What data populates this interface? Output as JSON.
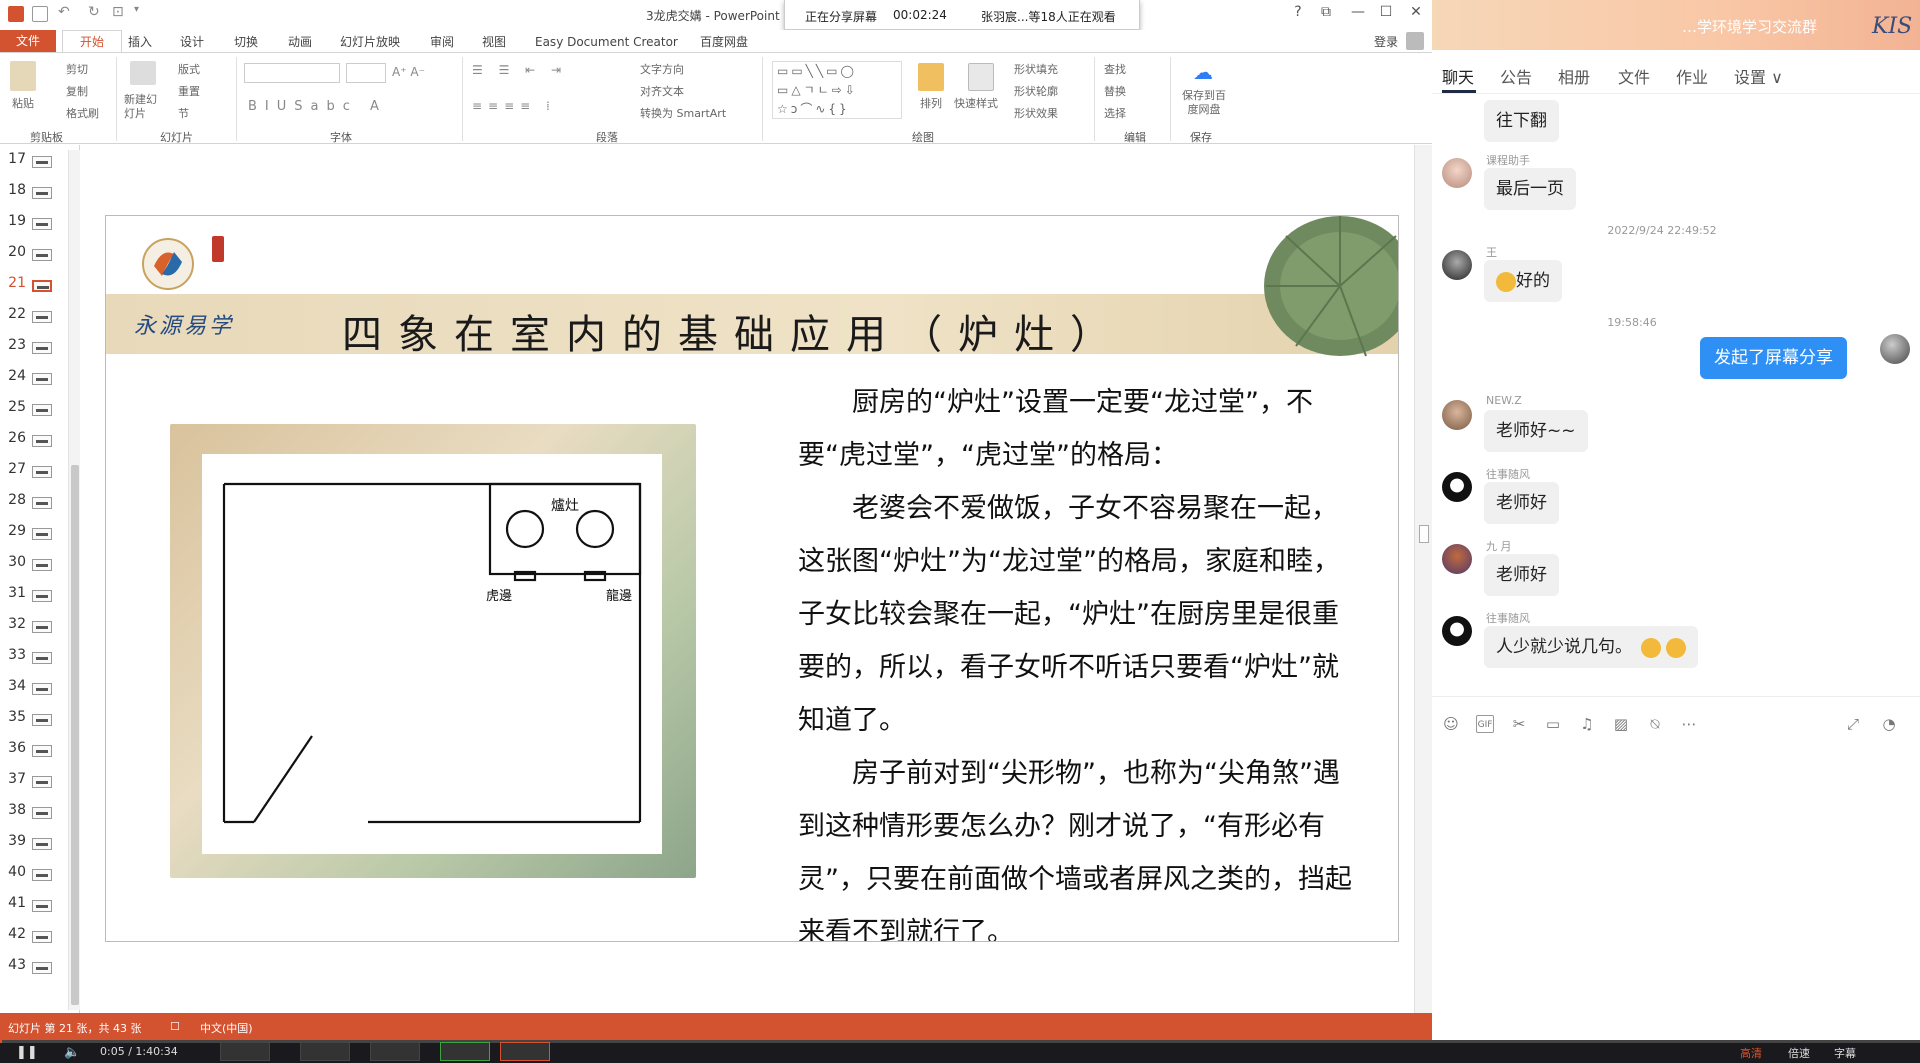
{
  "ppt": {
    "title": "3龙虎交媾 - PowerPoint",
    "share_banner": {
      "status": "正在分享屏幕",
      "timer": "00:02:24",
      "viewers": "张羽宸...等18人正在观看"
    },
    "window_controls": [
      "?",
      "⧉",
      "—",
      "☐",
      "✕"
    ],
    "login": "登录",
    "tabs": [
      "文件",
      "开始",
      "插入",
      "设计",
      "切换",
      "动画",
      "幻灯片放映",
      "审阅",
      "视图",
      "Easy Document Creator",
      "百度网盘"
    ],
    "active_tab": "开始",
    "ribbon": {
      "clipboard": {
        "paste": "粘贴",
        "cut": "剪切",
        "copy": "复制",
        "format_painter": "格式刷",
        "label": "剪贴板"
      },
      "slides": {
        "new_slide": "新建幻灯片",
        "layout": "版式",
        "reset": "重置",
        "section": "节",
        "label": "幻灯片"
      },
      "font": {
        "label": "字体"
      },
      "paragraph": {
        "text_direction": "文字方向",
        "align_text": "对齐文本",
        "smartart": "转换为 SmartArt",
        "label": "段落"
      },
      "drawing": {
        "arrange": "排列",
        "quick_styles": "快速样式",
        "shape_fill": "形状填充",
        "shape_outline": "形状轮廓",
        "shape_effects": "形状效果",
        "label": "绘图"
      },
      "editing": {
        "find": "查找",
        "replace": "替换",
        "select": "选择",
        "label": "编辑"
      },
      "save": {
        "save_baidu": "保存到百度网盘",
        "label": "保存"
      }
    },
    "thumbnails": [
      {
        "num": "17"
      },
      {
        "num": "18"
      },
      {
        "num": "19"
      },
      {
        "num": "20"
      },
      {
        "num": "21"
      },
      {
        "num": "22"
      },
      {
        "num": "23"
      },
      {
        "num": "24"
      },
      {
        "num": "25"
      },
      {
        "num": "26"
      },
      {
        "num": "27"
      },
      {
        "num": "28"
      },
      {
        "num": "29"
      },
      {
        "num": "30"
      },
      {
        "num": "31"
      },
      {
        "num": "32"
      },
      {
        "num": "33"
      },
      {
        "num": "34"
      },
      {
        "num": "35"
      },
      {
        "num": "36"
      },
      {
        "num": "37"
      },
      {
        "num": "38"
      },
      {
        "num": "39"
      },
      {
        "num": "40"
      },
      {
        "num": "41"
      },
      {
        "num": "42"
      },
      {
        "num": "43"
      }
    ],
    "active_slide": "21",
    "slide": {
      "title": "四象在室内的基础应用（炉灶）",
      "brand": "永源易学",
      "floorplan": {
        "stove_label": "爐灶",
        "left_label": "虎邊",
        "right_label": "龍邊"
      },
      "paragraphs": [
        "厨房的“炉灶”设置一定要“龙过堂”，不要“虎过堂”，“虎过堂”的格局：",
        "老婆会不爱做饭，子女不容易聚在一起，这张图“炉灶”为“龙过堂”的格局，家庭和睦，子女比较会聚在一起，“炉灶”在厨房里是很重要的，所以，看子女听不听话只要看“炉灶”就知道了。",
        "房子前对到“尖形物”，也称为“尖角煞”遇到这种情形要怎么办？刚才说了，“有形必有灵”，只要在前面做个墙或者屏风之类的，挡起来看不到就行了。"
      ]
    },
    "status": {
      "slide_info": "幻灯片 第 21 张，共 43 张",
      "language": "中文(中国)"
    }
  },
  "chat": {
    "group_name": "…学环境学习交流群",
    "tabs": [
      "聊天",
      "公告",
      "相册",
      "文件",
      "作业",
      "设置 ∨"
    ],
    "messages": [
      {
        "sender": "",
        "text": "往下翻"
      },
      {
        "sender": "课程助手",
        "text": "最后一页"
      },
      {
        "timestamp": "2022/9/24 22:49:52"
      },
      {
        "sender": "王",
        "text": "好的"
      },
      {
        "timestamp": "19:58:46"
      },
      {
        "self": true,
        "text": "发起了屏幕分享"
      },
      {
        "sender": "NEW.Z",
        "text": "老师好~~"
      },
      {
        "sender": "往事随风",
        "text": "老师好"
      },
      {
        "sender": "九 月",
        "text": "老师好"
      },
      {
        "sender": "往事随风",
        "text": "人少就少说几句。"
      }
    ]
  },
  "player": {
    "time": "0:05 / 1:40:34",
    "quality": "高清",
    "speed": "倍速",
    "subtitle": "字幕",
    "progress_fraction": 0.0008
  },
  "colors": {
    "ppt_accent": "#d35230",
    "chat_blue": "#2e90f5"
  }
}
